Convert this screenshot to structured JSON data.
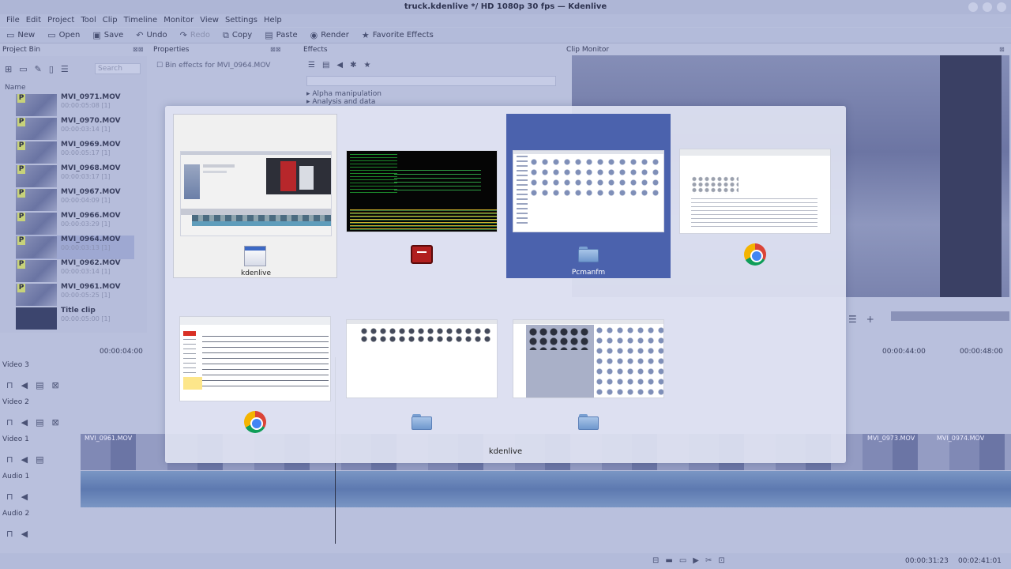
{
  "window": {
    "title": "truck.kdenlive */ HD 1080p 30 fps — Kdenlive"
  },
  "menu": [
    "File",
    "Edit",
    "Project",
    "Tool",
    "Clip",
    "Timeline",
    "Monitor",
    "View",
    "Settings",
    "Help"
  ],
  "toolbar": {
    "new": "New",
    "open": "Open",
    "save": "Save",
    "undo": "Undo",
    "redo": "Redo",
    "copy": "Copy",
    "paste": "Paste",
    "render": "Render",
    "favorite_effects": "Favorite Effects"
  },
  "docks": {
    "project_bin": "Project Bin",
    "properties": "Properties",
    "effects": "Effects",
    "clip_monitor": "Clip Monitor"
  },
  "bin": {
    "search_placeholder": "Search",
    "column_name": "Name",
    "clips": [
      {
        "name": "MVI_0971.MOV",
        "duration": "00:00:05:08 [1]"
      },
      {
        "name": "MVI_0970.MOV",
        "duration": "00:00:03:14 [1]"
      },
      {
        "name": "MVI_0969.MOV",
        "duration": "00:00:05:17 [1]"
      },
      {
        "name": "MVI_0968.MOV",
        "duration": "00:00:03:17 [1]"
      },
      {
        "name": "MVI_0967.MOV",
        "duration": "00:00:04:09 [1]"
      },
      {
        "name": "MVI_0966.MOV",
        "duration": "00:00:03:29 [1]"
      },
      {
        "name": "MVI_0964.MOV",
        "duration": "00:00:03:13 [1]"
      },
      {
        "name": "MVI_0962.MOV",
        "duration": "00:00:03:14 [1]"
      },
      {
        "name": "MVI_0961.MOV",
        "duration": "00:00:05:25 [1]"
      },
      {
        "name": "Title clip",
        "duration": "00:00:05:00 [1]"
      }
    ]
  },
  "properties": {
    "bin_effects_label": "Bin effects for MVI_0964.MOV"
  },
  "effects": {
    "categories": [
      "Alpha manipulation",
      "Analysis and data"
    ]
  },
  "timeline": {
    "ruler": [
      "00:00:04:00",
      "00:00:44:00",
      "00:00:48:00"
    ],
    "tracks": [
      "Video 3",
      "Video 2",
      "Video 1",
      "Audio 1",
      "Audio 2"
    ],
    "clips_v1": [
      "MVI_0961.MOV",
      "MVI_0973.MOV",
      "MVI_0974.MOV"
    ]
  },
  "status": {
    "position": "00:00:31:23",
    "duration": "00:02:41:01"
  },
  "switcher": {
    "selected_caption": "kdenlive",
    "windows": [
      {
        "caption": "kdenlive",
        "icon": "kdenlive-window-icon"
      },
      {
        "caption": "",
        "icon": "terminal-icon"
      },
      {
        "caption": "Pcmanfm",
        "icon": "folder-icon"
      },
      {
        "caption": "",
        "icon": "chrome-icon"
      },
      {
        "caption": "",
        "icon": "chrome-icon"
      },
      {
        "caption": "",
        "icon": "folder-icon"
      },
      {
        "caption": "",
        "icon": "folder-icon"
      }
    ]
  },
  "colors": {
    "selection": "#4b62ad",
    "overlay": "#e0e3f2"
  }
}
